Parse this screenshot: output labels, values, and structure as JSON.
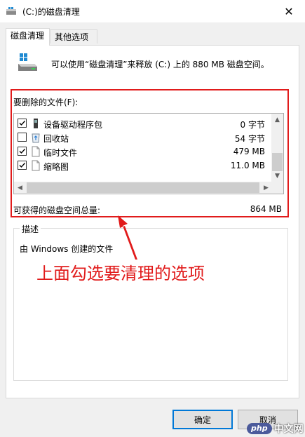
{
  "window": {
    "title": "(C:)的磁盘清理"
  },
  "tabs": [
    {
      "label": "磁盘清理"
    },
    {
      "label": "其他选项"
    }
  ],
  "intro": {
    "text": "可以使用“磁盘清理”来释放  (C:) 上的 880 MB 磁盘空间。"
  },
  "files": {
    "label": "要删除的文件(F):",
    "items": [
      {
        "name": "设备驱动程序包",
        "size": "0 字节",
        "checked": true,
        "icon": "driver-package-icon"
      },
      {
        "name": "回收站",
        "size": "54 字节",
        "checked": false,
        "icon": "recycle-bin-icon"
      },
      {
        "name": "临时文件",
        "size": "479 MB",
        "checked": true,
        "icon": "file-icon"
      },
      {
        "name": "缩略图",
        "size": "11.0 MB",
        "checked": true,
        "icon": "file-icon"
      }
    ]
  },
  "total": {
    "label": "可获得的磁盘空间总量:",
    "value": "864 MB"
  },
  "description": {
    "legend": "描述",
    "text": "由 Windows 创建的文件"
  },
  "annotation": {
    "text": "上面勾选要清理的选项"
  },
  "buttons": {
    "ok": "确定",
    "cancel": "取消"
  },
  "watermark": {
    "badge": "php",
    "text": "中文网"
  },
  "colors": {
    "highlight": "#e11b1b",
    "accent": "#0078d7"
  }
}
